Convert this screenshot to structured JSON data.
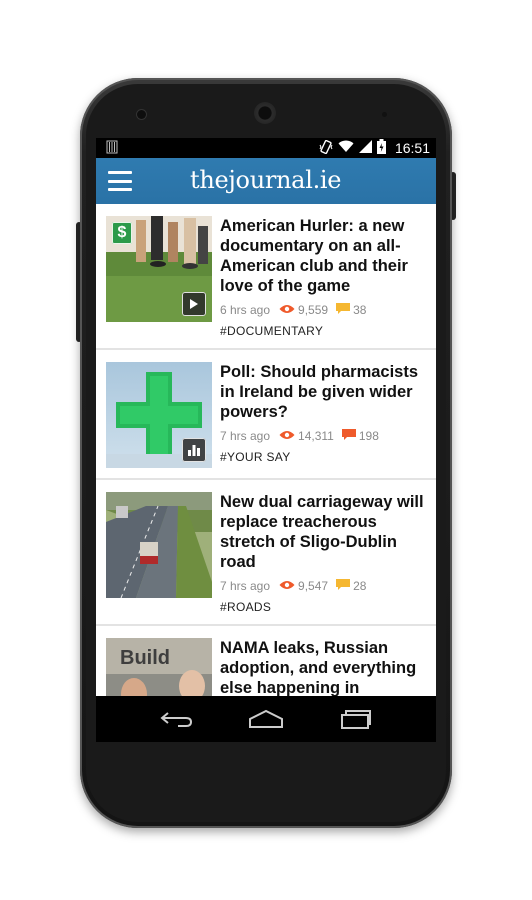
{
  "status_bar": {
    "time": "16:51",
    "icons": [
      "notification-icon",
      "vibrate-icon",
      "wifi-icon",
      "signal-icon",
      "battery-icon"
    ]
  },
  "app_bar": {
    "logo_prefix": "thejournal",
    "logo_suffix": ".ie",
    "menu_icon": "hamburger-menu-icon",
    "accent_color": "#2e78ad"
  },
  "articles": [
    {
      "headline": "American Hurler: a new documentary on an all-American club and their love of the game",
      "time": "6 hrs ago",
      "views": "9,559",
      "comments": "38",
      "comment_color": "#f5b731",
      "tag": "#DOCUMENTARY",
      "media_badge": "play-icon",
      "corner_badge": "$"
    },
    {
      "headline": "Poll: Should pharmacists in Ireland be given wider powers?",
      "time": "7 hrs ago",
      "views": "14,311",
      "comments": "198",
      "comment_color": "#ef5a2b",
      "tag": "#YOUR SAY",
      "media_badge": "poll-chart-icon"
    },
    {
      "headline": "New dual carriageway will replace treacherous stretch of Sligo-Dublin road",
      "time": "7 hrs ago",
      "views": "9,547",
      "comments": "28",
      "comment_color": "#f5b731",
      "tag": "#ROADS"
    },
    {
      "headline": "NAMA leaks, Russian adoption, and everything else happening in Leinster House today",
      "thumb_text": "Build"
    }
  ],
  "nav_bar": {
    "buttons": [
      "back-icon",
      "home-icon",
      "recent-apps-icon"
    ]
  }
}
